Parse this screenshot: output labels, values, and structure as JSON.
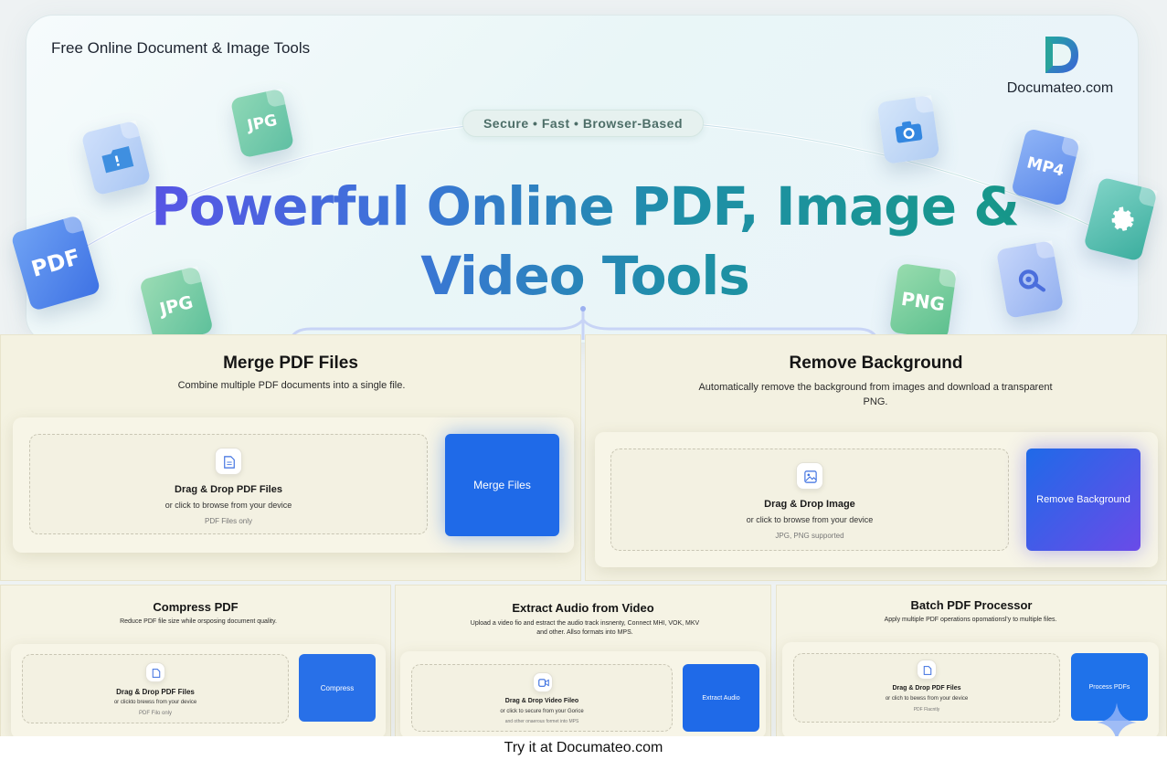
{
  "header": {
    "site_title": "Free Online Document & Image Tools",
    "brand": "Documateo.com",
    "tagline": "Secure • Fast • Browser-Based",
    "headline_line1": "Powerful Online PDF, Image &",
    "headline_line2": "Video Tools"
  },
  "floating_icons": {
    "jpg_top": "JPG",
    "pdf": "PDF",
    "jpg_bottom": "JPG",
    "mp4": "MP4",
    "png": "PNG"
  },
  "tools": {
    "merge": {
      "title": "Merge PDF Files",
      "desc": "Combine multiple PDF documents into a single file.",
      "drop_title": "Drag & Drop PDF Files",
      "drop_sub": "or click to browse from your device",
      "drop_note": "PDF Files only",
      "button": "Merge Files"
    },
    "remove_bg": {
      "title": "Remove Background",
      "desc_line1": "Automatically remove the background from images and download a transparent",
      "desc_line2": "PNG.",
      "drop_title": "Drag & Drop Image",
      "drop_sub": "or click to browse from your device",
      "drop_note": "JPG, PNG supported",
      "button": "Remove Background"
    },
    "compress": {
      "title": "Compress PDF",
      "desc": "Reduce PDF file size while orsposing document quality.",
      "drop_title": "Drag & Drop PDF Files",
      "drop_sub": "or clickto brewss from your device",
      "drop_note": "PDF Filo only",
      "button": "Compress"
    },
    "extract_audio": {
      "title": "Extract Audio from Video",
      "desc_line1": "Upload a video fio and estract the audio track insnenty, Connect MHI, VOK, MKV",
      "desc_line2": "and other. Allso formats into MPS.",
      "drop_title": "Drag & Drop Video Fileo",
      "drop_sub": "or click to secure from your Gorice",
      "drop_note": "and other onaerous formet into MPS",
      "button": "Extract Audio"
    },
    "batch": {
      "title": "Batch PDF Processor",
      "desc": "Apply multiple PDF operations opomationsl'y to multiple files.",
      "drop_title": "Drag & Drop PDF Files",
      "drop_sub": "or clich to bewss from your device",
      "drop_note": "PDF Flacntly",
      "button": "Process PDFs"
    }
  },
  "footer": {
    "text": "Try it at Documateo.com"
  },
  "colors": {
    "primary_blue": "#1f6ae8",
    "purple": "#6a4be8",
    "teal": "#169887",
    "card_bg": "#f5f3e4"
  }
}
